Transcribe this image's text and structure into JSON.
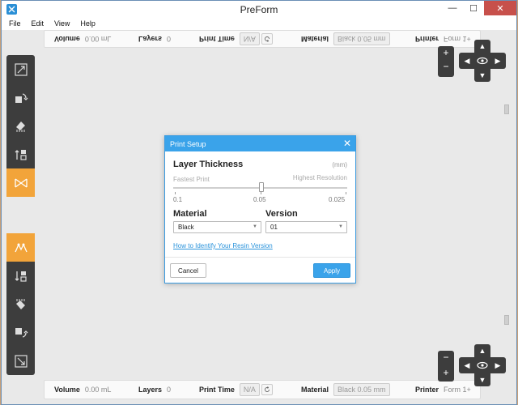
{
  "window": {
    "title": "PreForm",
    "minimize": "—",
    "maximize": "☐",
    "close": "✕"
  },
  "menu": [
    "File",
    "Edit",
    "View",
    "Help"
  ],
  "stats": {
    "volume_label": "Volume",
    "volume_value": "0.00 mL",
    "layers_label": "Layers",
    "layers_value": "0",
    "print_time_label": "Print Time",
    "print_time_value": "N/A",
    "material_label": "Material",
    "material_value": "Black 0.05 mm",
    "printer_label": "Printer",
    "printer_value": "Form 1+"
  },
  "toolbar_top": [
    "expand-icon",
    "rotate-icon",
    "orient-icon",
    "layout-icon",
    "supports-icon"
  ],
  "toolbar_bottom": [
    "supports-icon",
    "layout-icon",
    "orient-icon",
    "rotate-icon",
    "expand-icon"
  ],
  "view_controls": {
    "zoom_in": "+",
    "zoom_out": "−",
    "up": "▲",
    "down": "▼",
    "left": "◀",
    "right": "▶"
  },
  "dialog": {
    "title": "Print Setup",
    "close": "✕",
    "layer_thickness_title": "Layer Thickness",
    "unit": "(mm)",
    "fastest_label": "Fastest Print",
    "highest_label": "Highest Resolution",
    "ticks": [
      "0.1",
      "0.05",
      "0.025"
    ],
    "slider_value": 0.05,
    "material_title": "Material",
    "version_title": "Version",
    "material_value": "Black",
    "version_value": "01",
    "help_link": "How to Identify Your Resin Version",
    "cancel": "Cancel",
    "apply": "Apply"
  },
  "colors": {
    "accent": "#3aa3ea",
    "toolbar": "#3d3d3d",
    "active_tool": "#f2a43a"
  }
}
